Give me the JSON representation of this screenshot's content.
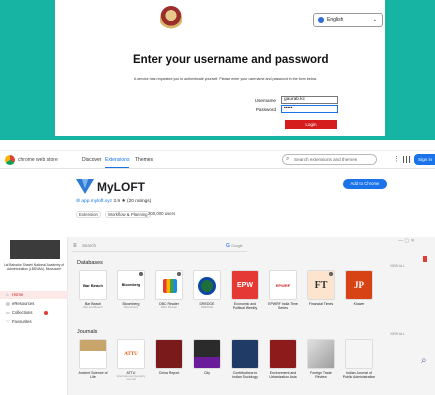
{
  "login": {
    "language": "English",
    "title": "Enter your username and password",
    "subtitle": "A service has requested you to authenticate yourself. Please enter your username and password in the form below.",
    "username_label": "Username",
    "username_value": "gaurab.kc",
    "password_label": "Password",
    "password_value": "•••••",
    "login_button": "Login"
  },
  "cws": {
    "store_name": "chrome web store",
    "nav": [
      "Discover",
      "Extensions",
      "Themes"
    ],
    "search_placeholder": "Search extensions and themes",
    "sign_in": "Sign in",
    "ext_name": "MyLOFT",
    "ext_site": "app.myloft.xyz",
    "ext_rating": "3.9 ★ (20 ratings)",
    "chips": [
      "Extension",
      "Workflow & Planning",
      "200,000 users"
    ],
    "add_button": "Add to Chrome",
    "colors": {
      "accent": "#1a73e8"
    }
  },
  "myloft": {
    "institution": "Lal Bahadur Shastri National Academy of Administration (LBSNAA), Mussoorie",
    "menu": [
      "Home",
      "eResources",
      "Collections",
      "Favourites"
    ],
    "search_placeholder": "Search",
    "google_label": "Google",
    "view_all": "VIEW ALL",
    "databases_title": "Databases",
    "journals_title": "Journals",
    "databases": [
      {
        "title": "Bar Beach",
        "sub": "Bar and Beach"
      },
      {
        "title": "Bloomberg",
        "sub": "Bloomberg"
      },
      {
        "title": "DBC Reader",
        "sub": "DBC Reader"
      },
      {
        "title": "DREDGE",
        "sub": "DREDGE"
      },
      {
        "title": "EPW",
        "sub": "Economic and Political Weekly"
      },
      {
        "title": "EPWRF",
        "sub": "EPWRF India Time Series"
      },
      {
        "title": "FT",
        "sub": "Financial Times"
      },
      {
        "title": "JP",
        "sub": "Kluwer"
      }
    ],
    "journals": [
      {
        "title": "Ancient Science of Life",
        "sub": ""
      },
      {
        "title": "ATTU",
        "sub": "International Quarterly Journal"
      },
      {
        "title": "China Report",
        "sub": ""
      },
      {
        "title": "City",
        "sub": ""
      },
      {
        "title": "Contributions to Indian Sociology",
        "sub": ""
      },
      {
        "title": "Environment and Urbanization Asia",
        "sub": ""
      },
      {
        "title": "Foreign Trade Review",
        "sub": ""
      },
      {
        "title": "Indian Journal of Public Administration",
        "sub": ""
      }
    ]
  }
}
